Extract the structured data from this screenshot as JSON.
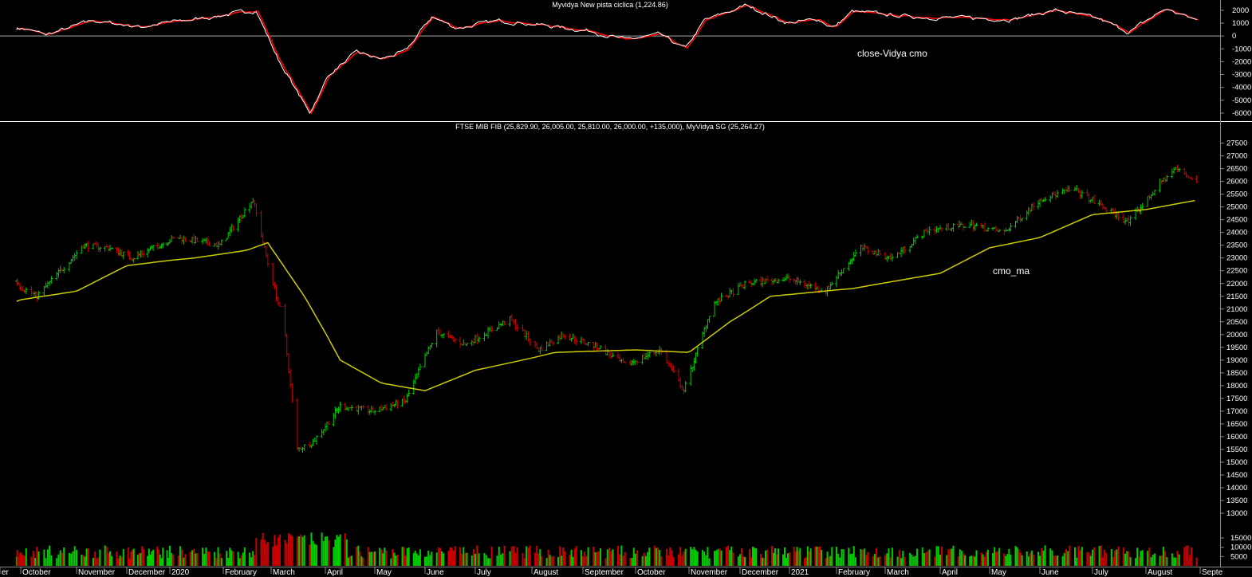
{
  "colors": {
    "background": "#000000",
    "text": "#ffffff",
    "up_bar": "#00cc00",
    "down_bar": "#cc0000",
    "ma_line": "#cccc00",
    "osc_line_1": "#ffffff",
    "osc_line_2": "#ff0000",
    "separator": "#ffffff"
  },
  "chart_data": [
    {
      "type": "line",
      "title": "Myvidya New pista ciclica (1,224.86)",
      "annotation": "close-Vidya cmo",
      "ylim": [
        -6500,
        2800
      ],
      "y_ticks": [
        2000,
        1000,
        0,
        -1000,
        -2000,
        -3000,
        -4000,
        -5000,
        -6000
      ],
      "zero_line": true,
      "key_points": [
        {
          "date": "2019-10-01",
          "value": 600
        },
        {
          "date": "2019-10-15",
          "value": 100
        },
        {
          "date": "2019-11-10",
          "value": 1200
        },
        {
          "date": "2019-12-10",
          "value": 700
        },
        {
          "date": "2020-01-15",
          "value": 1300
        },
        {
          "date": "2020-02-21",
          "value": 2000
        },
        {
          "date": "2020-03-05",
          "value": -1800
        },
        {
          "date": "2020-03-23",
          "value": -6000
        },
        {
          "date": "2020-04-03",
          "value": -3000
        },
        {
          "date": "2020-04-20",
          "value": -1300
        },
        {
          "date": "2020-05-05",
          "value": -1800
        },
        {
          "date": "2020-05-20",
          "value": -1200
        },
        {
          "date": "2020-06-05",
          "value": 1500
        },
        {
          "date": "2020-06-20",
          "value": 600
        },
        {
          "date": "2020-07-15",
          "value": 1200
        },
        {
          "date": "2020-08-10",
          "value": 800
        },
        {
          "date": "2020-09-05",
          "value": 400
        },
        {
          "date": "2020-09-25",
          "value": -300
        },
        {
          "date": "2020-10-15",
          "value": 100
        },
        {
          "date": "2020-10-30",
          "value": -1000
        },
        {
          "date": "2020-11-10",
          "value": 1200
        },
        {
          "date": "2020-12-05",
          "value": 2400
        },
        {
          "date": "2020-12-31",
          "value": 1000
        },
        {
          "date": "2021-01-20",
          "value": 1300
        },
        {
          "date": "2021-01-30",
          "value": 600
        },
        {
          "date": "2021-02-10",
          "value": 1900
        },
        {
          "date": "2021-03-15",
          "value": 1500
        },
        {
          "date": "2021-04-15",
          "value": 1400
        },
        {
          "date": "2021-05-15",
          "value": 1300
        },
        {
          "date": "2021-06-10",
          "value": 2000
        },
        {
          "date": "2021-07-05",
          "value": 1300
        },
        {
          "date": "2021-07-22",
          "value": 300
        },
        {
          "date": "2021-08-12",
          "value": 2100
        },
        {
          "date": "2021-08-30",
          "value": 1224.86
        }
      ]
    },
    {
      "type": "ohlc",
      "title": "FTSE MIB FIB (25,829.90, 26,005.00, 25,810.00, 26,000.00, +135,000), MyVidya SG (25,264.27)",
      "annotation": "cmo_ma",
      "ylim": [
        12500,
        27800
      ],
      "y_ticks": [
        27500,
        27000,
        26500,
        26000,
        25500,
        25000,
        24500,
        24000,
        23500,
        23000,
        22500,
        22000,
        21500,
        21000,
        20500,
        20000,
        19500,
        19000,
        18500,
        18000,
        17500,
        17000,
        16500,
        16000,
        15500,
        15000,
        14500,
        14000,
        13500,
        13000
      ],
      "price_key_points": [
        {
          "date": "2019-09-25",
          "close": 22100
        },
        {
          "date": "2019-10-10",
          "close": 21500
        },
        {
          "date": "2019-11-05",
          "close": 23500
        },
        {
          "date": "2019-11-20",
          "close": 23400
        },
        {
          "date": "2019-12-05",
          "close": 23000
        },
        {
          "date": "2020-01-05",
          "close": 23800
        },
        {
          "date": "2020-01-30",
          "close": 23500
        },
        {
          "date": "2020-02-19",
          "close": 25300
        },
        {
          "date": "2020-02-28",
          "close": 22800
        },
        {
          "date": "2020-03-08",
          "close": 20500
        },
        {
          "date": "2020-03-16",
          "close": 15500
        },
        {
          "date": "2020-03-25",
          "close": 15800
        },
        {
          "date": "2020-04-10",
          "close": 17200
        },
        {
          "date": "2020-04-30",
          "close": 17000
        },
        {
          "date": "2020-05-20",
          "close": 17400
        },
        {
          "date": "2020-06-08",
          "close": 20100
        },
        {
          "date": "2020-06-25",
          "close": 19600
        },
        {
          "date": "2020-07-20",
          "close": 20600
        },
        {
          "date": "2020-08-05",
          "close": 19400
        },
        {
          "date": "2020-08-20",
          "close": 20000
        },
        {
          "date": "2020-09-10",
          "close": 19500
        },
        {
          "date": "2020-09-25",
          "close": 18800
        },
        {
          "date": "2020-10-15",
          "close": 19400
        },
        {
          "date": "2020-10-29",
          "close": 17800
        },
        {
          "date": "2020-11-15",
          "close": 21200
        },
        {
          "date": "2020-12-05",
          "close": 22000
        },
        {
          "date": "2020-12-31",
          "close": 22200
        },
        {
          "date": "2021-01-25",
          "close": 21700
        },
        {
          "date": "2021-02-15",
          "close": 23400
        },
        {
          "date": "2021-03-05",
          "close": 23000
        },
        {
          "date": "2021-03-25",
          "close": 24100
        },
        {
          "date": "2021-04-20",
          "close": 24300
        },
        {
          "date": "2021-05-10",
          "close": 24000
        },
        {
          "date": "2021-06-01",
          "close": 25300
        },
        {
          "date": "2021-06-20",
          "close": 25700
        },
        {
          "date": "2021-07-07",
          "close": 25000
        },
        {
          "date": "2021-07-22",
          "close": 24400
        },
        {
          "date": "2021-08-10",
          "close": 26000
        },
        {
          "date": "2021-08-18",
          "close": 26500
        },
        {
          "date": "2021-08-30",
          "close": 26000
        }
      ],
      "ma_key_points": [
        {
          "date": "2019-09-25",
          "value": 21300
        },
        {
          "date": "2019-11-01",
          "value": 21700
        },
        {
          "date": "2019-12-01",
          "value": 22700
        },
        {
          "date": "2020-01-15",
          "value": 23000
        },
        {
          "date": "2020-02-15",
          "value": 23300
        },
        {
          "date": "2020-02-28",
          "value": 23600
        },
        {
          "date": "2020-03-20",
          "value": 21500
        },
        {
          "date": "2020-04-10",
          "value": 19000
        },
        {
          "date": "2020-05-05",
          "value": 18100
        },
        {
          "date": "2020-06-01",
          "value": 17800
        },
        {
          "date": "2020-07-01",
          "value": 18600
        },
        {
          "date": "2020-08-15",
          "value": 19300
        },
        {
          "date": "2020-10-01",
          "value": 19400
        },
        {
          "date": "2020-11-01",
          "value": 19300
        },
        {
          "date": "2020-11-25",
          "value": 20500
        },
        {
          "date": "2020-12-20",
          "value": 21500
        },
        {
          "date": "2021-02-10",
          "value": 21800
        },
        {
          "date": "2021-04-01",
          "value": 22400
        },
        {
          "date": "2021-05-01",
          "value": 23400
        },
        {
          "date": "2021-06-01",
          "value": 23800
        },
        {
          "date": "2021-07-01",
          "value": 24700
        },
        {
          "date": "2021-08-01",
          "value": 24900
        },
        {
          "date": "2021-08-30",
          "value": 25264.27
        }
      ],
      "volume_y_ticks": [
        15000,
        10000,
        5000
      ]
    }
  ],
  "x_axis": {
    "labels": [
      "er",
      "October",
      "November",
      "December",
      "2020",
      "February",
      "March",
      "April",
      "May",
      "June",
      "July",
      "August",
      "September",
      "October",
      "November",
      "December",
      "2021",
      "February",
      "March",
      "April",
      "May",
      "June",
      "July",
      "August",
      "Septe"
    ],
    "label_dates": [
      "2019-09-01",
      "2019-10-01",
      "2019-11-01",
      "2019-12-01",
      "2020-01-01",
      "2020-02-01",
      "2020-03-01",
      "2020-04-01",
      "2020-05-01",
      "2020-06-01",
      "2020-07-01",
      "2020-08-01",
      "2020-09-01",
      "2020-10-01",
      "2020-11-01",
      "2020-12-01",
      "2021-01-01",
      "2021-02-01",
      "2021-03-01",
      "2021-04-01",
      "2021-05-01",
      "2021-06-01",
      "2021-07-01",
      "2021-08-01",
      "2021-09-01"
    ]
  }
}
